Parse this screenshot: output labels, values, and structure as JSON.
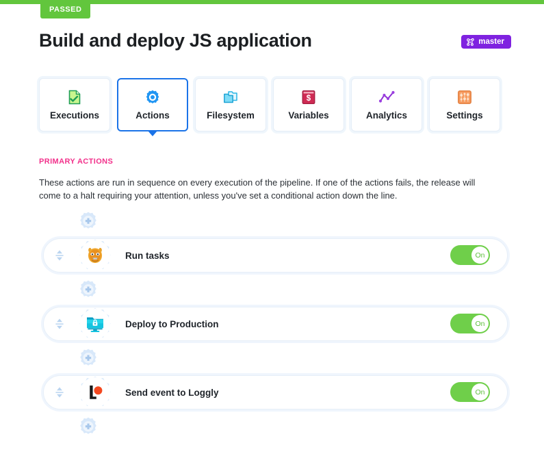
{
  "status": {
    "badge_label": "PASSED",
    "bar_color": "#62c63d"
  },
  "header": {
    "title": "Build and deploy JS application",
    "branch": {
      "label": "master",
      "icon": "git-branch-icon",
      "color": "#7f22e0"
    }
  },
  "tabs": [
    {
      "label": "Executions",
      "icon": "document-check-icon",
      "active": false
    },
    {
      "label": "Actions",
      "icon": "gear-icon",
      "active": true
    },
    {
      "label": "Filesystem",
      "icon": "folder-copy-icon",
      "active": false
    },
    {
      "label": "Variables",
      "icon": "dollar-box-icon",
      "active": false
    },
    {
      "label": "Analytics",
      "icon": "line-chart-icon",
      "active": false
    },
    {
      "label": "Settings",
      "icon": "sliders-icon",
      "active": false
    }
  ],
  "section": {
    "heading": "PRIMARY ACTIONS",
    "heading_color": "#f2318b",
    "description": "These actions are run in sequence on every execution of the pipeline. If one of the actions fails, the release will come to a halt requiring your attention, unless you've set a conditional action down the line."
  },
  "add_button": {
    "icon": "add-gear-icon",
    "label": "+"
  },
  "actions": [
    {
      "label": "Run tasks",
      "icon": "gradle-icon",
      "toggle": {
        "state_label": "On",
        "on": true
      }
    },
    {
      "label": "Deploy to Production",
      "icon": "sftp-folder-lock-icon",
      "toggle": {
        "state_label": "On",
        "on": true
      }
    },
    {
      "label": "Send event to Loggly",
      "icon": "loggly-icon",
      "toggle": {
        "state_label": "On",
        "on": true
      }
    }
  ],
  "drag_handle": {
    "icon": "reorder-handle-icon"
  },
  "colors": {
    "accent_blue": "#1a73e8",
    "toggle_green": "#6fcf4a",
    "pink": "#f2318b",
    "purple": "#7f22e0"
  }
}
